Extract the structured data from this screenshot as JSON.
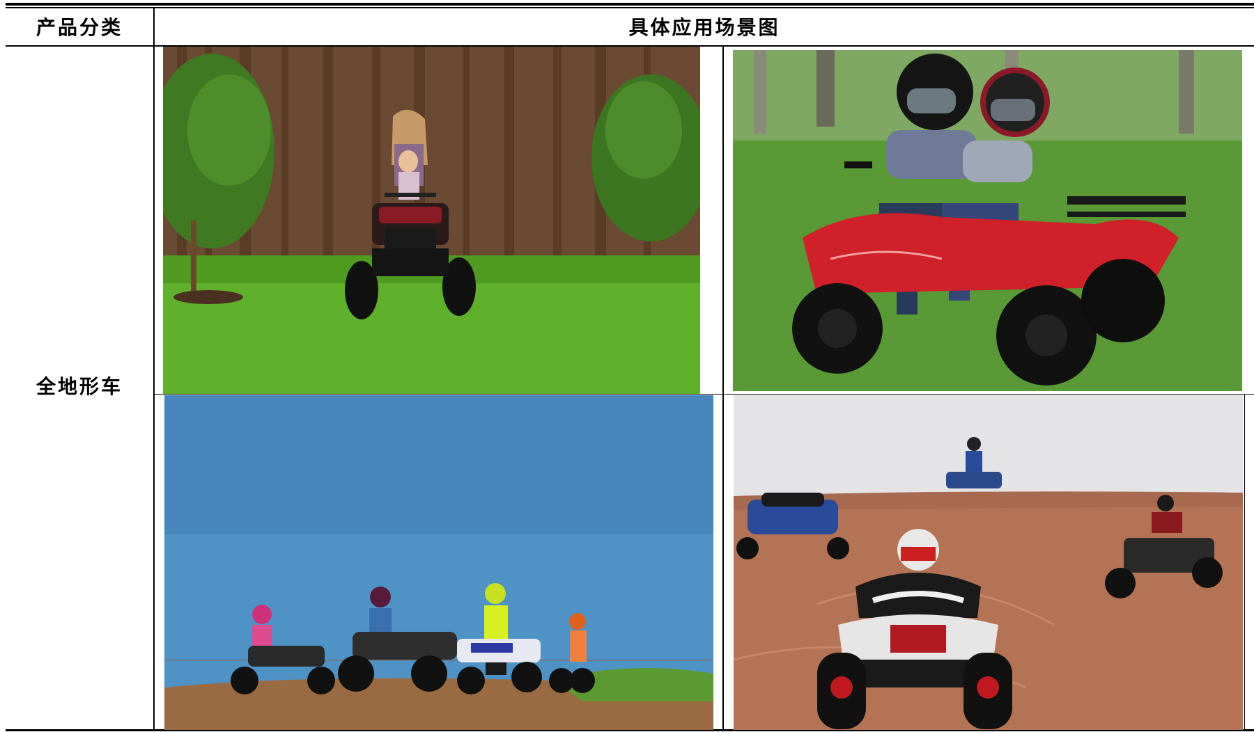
{
  "table": {
    "header": {
      "category": "产品分类",
      "scene": "具体应用场景图"
    },
    "rows": [
      {
        "category": "全地形车",
        "images": [
          {
            "icon": "photo-two-girls-atv-backyard-lawn"
          },
          {
            "icon": "photo-two-kids-helmets-red-atv-grass"
          },
          {
            "icon": "photo-kids-riders-atvs-blue-sky-dirt-ridge"
          },
          {
            "icon": "photo-riders-atvs-buggy-desert-sand"
          }
        ]
      }
    ]
  },
  "colors": {
    "rule": "#000000",
    "background": "#ffffff"
  }
}
